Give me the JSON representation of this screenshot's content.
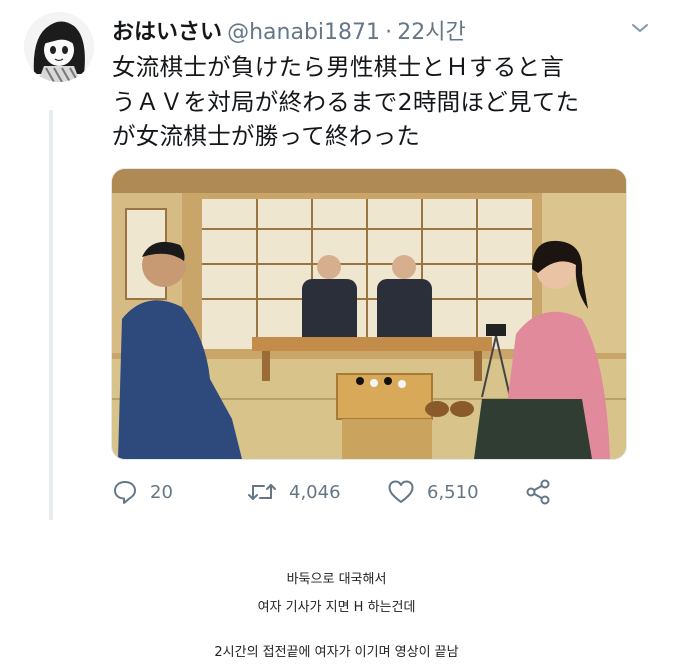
{
  "tweet": {
    "display_name": "おはいさい",
    "handle": "@hanabi1871",
    "separator": "·",
    "time": "22시간",
    "text_lines": [
      "女流棋士が負けたら男性棋士とＨすると言",
      "うＡＶを対局が終わるまで2時間ほど見てた",
      "が女流棋士が勝って終わった"
    ],
    "avatar_icon": "anime-avatar-icon",
    "menu_icon": "chevron-down-icon"
  },
  "actions": {
    "reply": {
      "icon": "reply-icon",
      "count": "20"
    },
    "retweet": {
      "icon": "retweet-icon",
      "count": "4,046"
    },
    "like": {
      "icon": "heart-icon",
      "count": "6,510"
    },
    "share": {
      "icon": "share-icon"
    }
  },
  "caption": {
    "lines": [
      "바둑으로 대국해서",
      "여자 기사가 지면 H 하는건데",
      "2시간의 접전끝에 여자가 이기며 영상이 끝남"
    ]
  },
  "colors": {
    "text": "#14171a",
    "muted": "#657786",
    "thread_line": "#e6ecf0"
  }
}
